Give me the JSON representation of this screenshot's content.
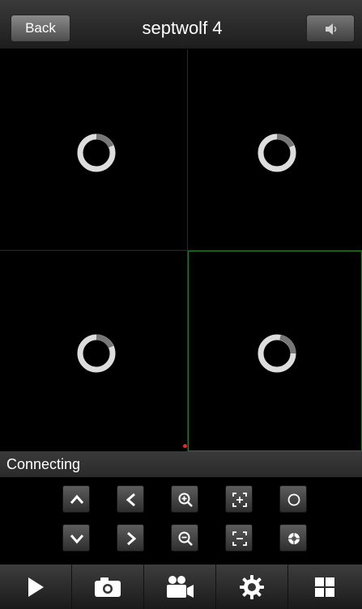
{
  "header": {
    "back_label": "Back",
    "title": "septwolf 4",
    "audio_icon": "speaker-muted-icon"
  },
  "video_grid": {
    "cells": [
      {
        "state": "loading"
      },
      {
        "state": "loading"
      },
      {
        "state": "loading"
      },
      {
        "state": "loading",
        "selected": true
      }
    ],
    "selected_border_color": "#1f7a1f"
  },
  "status": {
    "text": "Connecting"
  },
  "ptz_controls": {
    "row1": [
      "tilt-up-icon",
      "pan-left-icon",
      "zoom-in-icon",
      "focus-near-icon",
      "iris-open-icon"
    ],
    "row2": [
      "tilt-down-icon",
      "pan-right-icon",
      "zoom-out-icon",
      "focus-far-icon",
      "iris-close-icon"
    ]
  },
  "toolbar": {
    "items": [
      "play-icon",
      "camera-snapshot-icon",
      "video-record-icon",
      "settings-gear-icon",
      "grid-layout-icon"
    ]
  }
}
